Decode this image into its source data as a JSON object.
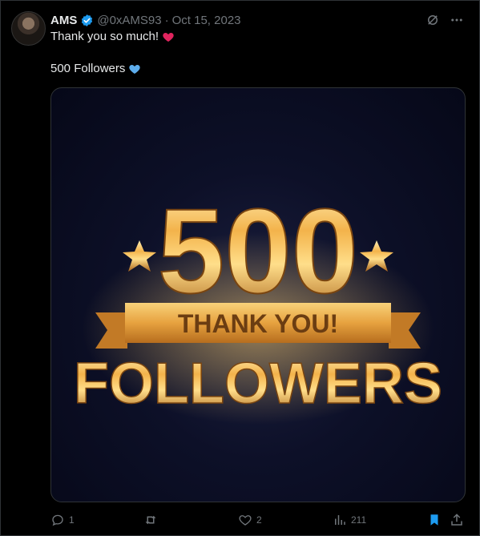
{
  "tweet": {
    "author_name": "AMS",
    "handle": "@0xAMS93",
    "separator": "·",
    "date": "Oct 15, 2023",
    "line1": "Thank you so much!",
    "line2": "500 Followers",
    "line1_emoji": "red-heart",
    "line2_emoji": "blue-heart"
  },
  "media": {
    "big_number": "500",
    "banner_text": "THANK YOU!",
    "bottom_text": "FOLLOWERS"
  },
  "actions": {
    "replies": "1",
    "retweets": "",
    "likes": "2",
    "views": "211"
  },
  "colors": {
    "background": "#000000",
    "text": "#e7e9ea",
    "muted": "#71767b",
    "verified": "#1d9bf0",
    "bookmark_active": "#1d9bf0",
    "gold": "#f3b34b"
  }
}
